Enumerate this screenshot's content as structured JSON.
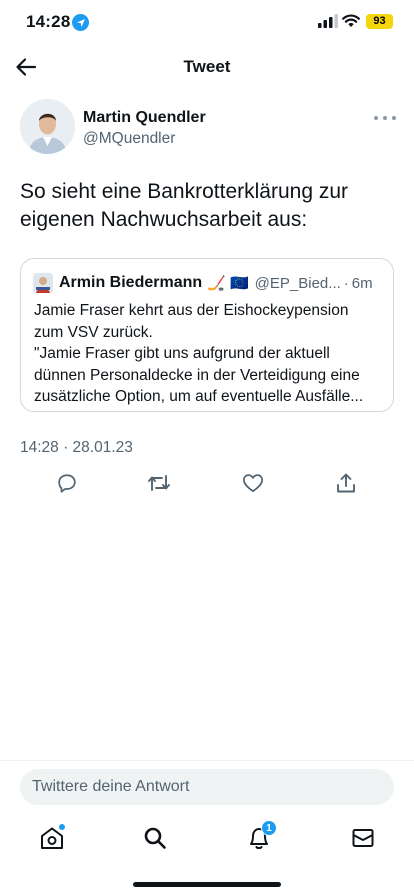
{
  "status_bar": {
    "time": "14:28",
    "battery": "93"
  },
  "header": {
    "title": "Tweet"
  },
  "tweet": {
    "author_name": "Martin Quendler",
    "author_handle": "@MQuendler",
    "text_lines": [
      "So sieht eine Bankrotterklärung zur",
      "eigenen Nachwuchsarbeit aus:"
    ],
    "timestamp": "14:28 · 28.01.23"
  },
  "quote": {
    "name": "Armin Biedermann",
    "emoji": "🏒 🇪🇺",
    "handle": "@EP_Bied...",
    "separator": "·",
    "time": "6m",
    "lines": [
      "Jamie Fraser kehrt aus der Eishockeypension",
      "zum VSV zurück.",
      "\"Jamie Fraser gibt uns aufgrund der aktuell",
      "dünnen Personaldecke in der Verteidigung eine",
      "zusätzliche Option, um auf eventuelle Ausfälle..."
    ]
  },
  "reply": {
    "placeholder": "Twittere deine Antwort"
  },
  "tabbar": {
    "notification_count": "1"
  },
  "colors": {
    "accent": "#1d9bf0",
    "text": "#0f1419",
    "secondary": "#536471",
    "battery": "#f5d50b"
  }
}
